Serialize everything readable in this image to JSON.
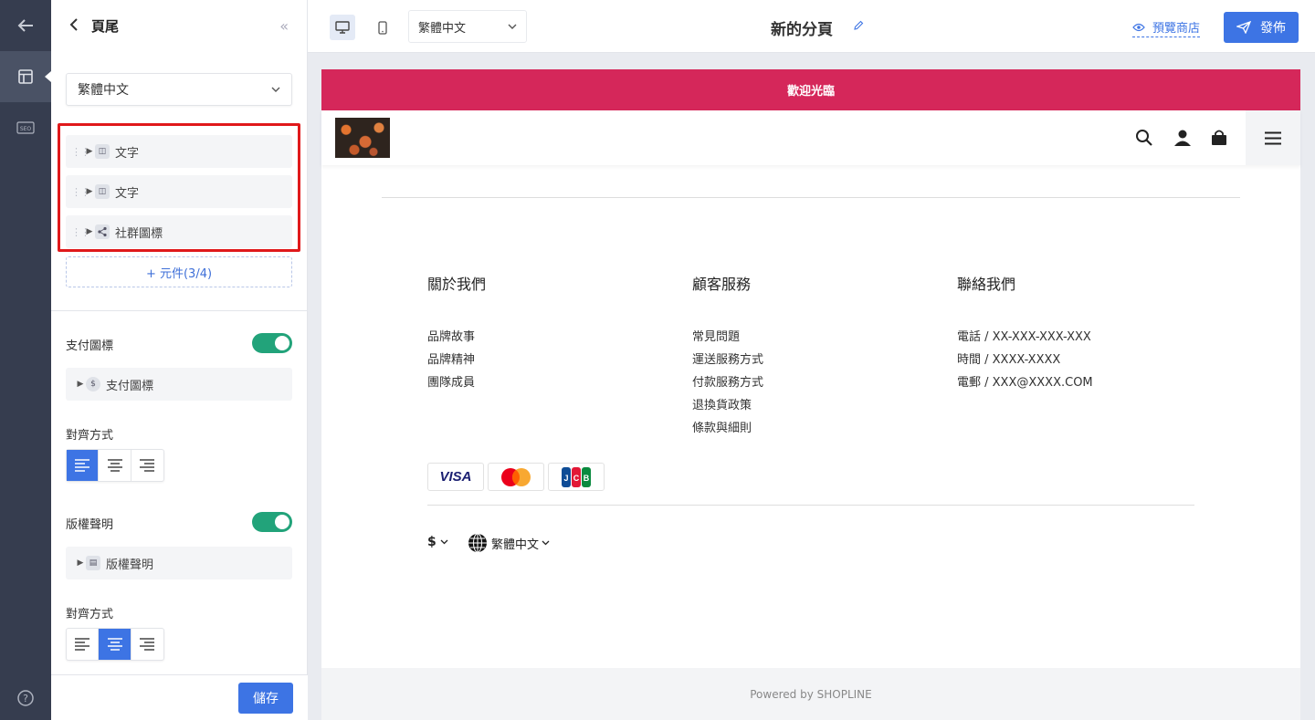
{
  "panel": {
    "title": "頁尾",
    "language": "繁體中文",
    "blocks": [
      {
        "label": "文字",
        "icon": "text-block-icon"
      },
      {
        "label": "文字",
        "icon": "text-block-icon"
      },
      {
        "label": "社群圖標",
        "icon": "share-icon"
      }
    ],
    "add_block": "+ 元件(3/4)",
    "payment_section": {
      "label": "支付圖標",
      "item": "支付圖標",
      "enabled": true
    },
    "payment_align_label": "對齊方式",
    "payment_align_selected": "left",
    "copyright_section": {
      "label": "版權聲明",
      "item": "版權聲明",
      "enabled": true
    },
    "copyright_align_label": "對齊方式",
    "copyright_align_selected": "center",
    "save": "儲存"
  },
  "topbar": {
    "language": "繁體中文",
    "page_title": "新的分頁",
    "preview": "預覽商店",
    "publish": "發佈"
  },
  "store": {
    "announcement": "歡迎光臨",
    "columns": [
      {
        "title": "關於我們",
        "links": [
          "品牌故事",
          "品牌精神",
          "團隊成員"
        ]
      },
      {
        "title": "顧客服務",
        "links": [
          "常見問題",
          "運送服務方式",
          "付款服務方式",
          "退換貨政策",
          "條款與細則"
        ]
      },
      {
        "title": "聯絡我們",
        "links": [
          "電話 / XX-XXX-XXX-XXX",
          "時間 / XXXX-XXXX",
          "電郵 / XXX@XXXX.COM"
        ]
      }
    ],
    "payment_methods": [
      "VISA",
      "Mastercard",
      "JCB"
    ],
    "currency": "$",
    "footer_language": "繁體中文",
    "powered_by": "Powered by SHOPLINE"
  },
  "colors": {
    "announcement_bg": "#d5275a",
    "primary": "#3d74e4",
    "toggle_on": "#22a37a",
    "rail_bg": "#363d4f",
    "highlight_border": "#e0191b"
  }
}
